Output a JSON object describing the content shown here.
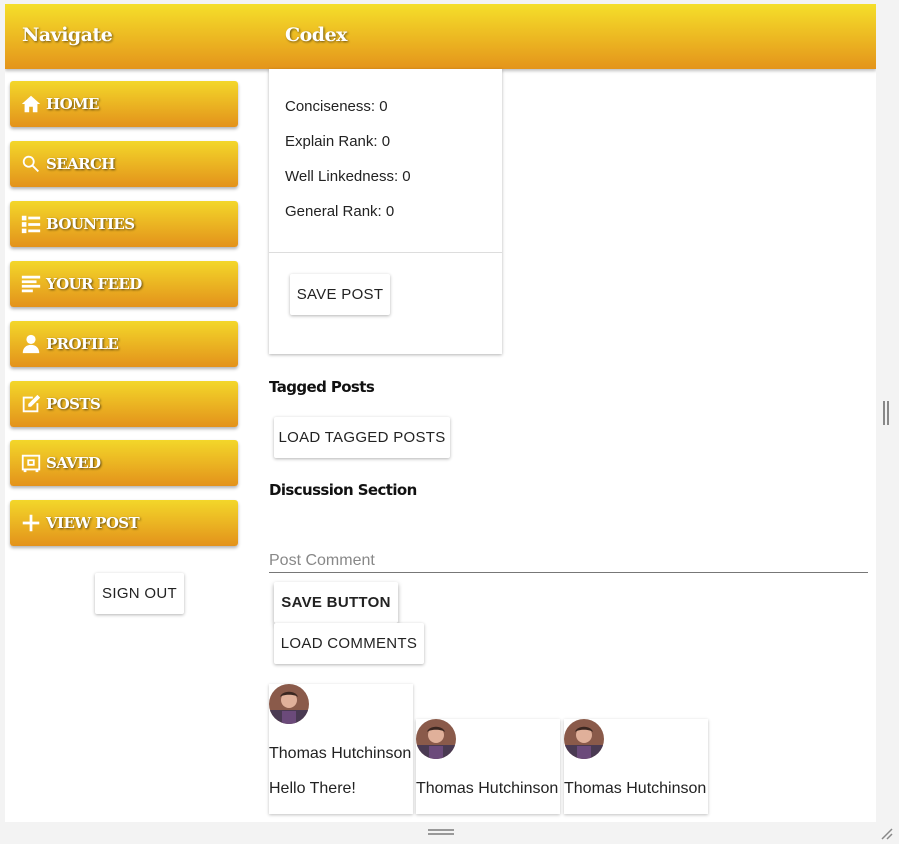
{
  "header": {
    "nav_title": "Navigate",
    "app_title": "Codex"
  },
  "colors": {
    "gold_top": "#f5df2a",
    "gold_bottom": "#e4941b"
  },
  "nav": [
    {
      "label": "HOME",
      "icon": "home-icon"
    },
    {
      "label": "SEARCH",
      "icon": "search-icon"
    },
    {
      "label": "BOUNTIES",
      "icon": "list-icon"
    },
    {
      "label": "YOUR FEED",
      "icon": "feed-icon"
    },
    {
      "label": "PROFILE",
      "icon": "person-icon"
    },
    {
      "label": "POSTS",
      "icon": "edit-icon"
    },
    {
      "label": "SAVED",
      "icon": "safe-icon"
    },
    {
      "label": "VIEW POST",
      "icon": "plus-icon"
    }
  ],
  "sign_out": "SIGN OUT",
  "post_card": {
    "stats": [
      "Conciseness: 0",
      "Explain Rank: 0",
      "Well Linkedness: 0",
      "General Rank: 0"
    ],
    "save_post": "SAVE POST"
  },
  "tagged": {
    "heading": "Tagged Posts",
    "load_button": "LOAD TAGGED POSTS"
  },
  "discussion": {
    "heading": "Discussion Section",
    "comment_placeholder": "Post Comment",
    "save_button": "SAVE BUTTON",
    "load_comments": "LOAD COMMENTS"
  },
  "comments": [
    {
      "author": "Thomas Hutchinson",
      "text": "Hello There!"
    },
    {
      "author": "Thomas Hutchinson",
      "text": ""
    },
    {
      "author": "Thomas Hutchinson",
      "text": ""
    }
  ]
}
